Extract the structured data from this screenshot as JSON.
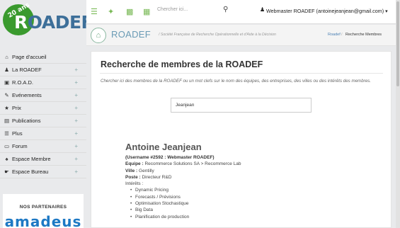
{
  "logo": {
    "anniversary": "20 ans",
    "text_prefix": "",
    "text_r": "R",
    "text_rest": "OADEF"
  },
  "sidebar": {
    "items": [
      {
        "label": "Page d'accueil",
        "icon": "home-icon",
        "has_expand": false
      },
      {
        "label": "La ROADEF",
        "icon": "person-icon",
        "has_expand": true
      },
      {
        "label": "R.O.A.D.",
        "icon": "book-icon",
        "has_expand": true
      },
      {
        "label": "Evénements",
        "icon": "edit-icon",
        "has_expand": true
      },
      {
        "label": "Prix",
        "icon": "trophy-icon",
        "has_expand": true
      },
      {
        "label": "Publications",
        "icon": "document-icon",
        "has_expand": true
      },
      {
        "label": "Plus",
        "icon": "list-icon",
        "has_expand": true
      },
      {
        "label": "Forum",
        "icon": "monitor-icon",
        "has_expand": true
      },
      {
        "label": "Espace Membre",
        "icon": "group-icon",
        "has_expand": true
      },
      {
        "label": "Espace Bureau",
        "icon": "handshake-icon",
        "has_expand": true
      }
    ],
    "partners_title": "NOS PARTENAIRES",
    "partner_logo": "amadeus"
  },
  "topbar": {
    "search_placeholder": "Chercher ici...",
    "user": "Webmaster ROADEF (antoinejeanjean@gmail.com)",
    "icons": [
      "menu-icon",
      "twitter-icon",
      "facebook-icon",
      "linkedin-icon",
      "search-icon",
      "user-icon"
    ]
  },
  "header": {
    "title": "ROADEF",
    "subtitle": "/ Société Française de Recherche Opérationnelle et d'Aide à la Décision",
    "crumb_home": "Roadef",
    "crumb_sep": "/",
    "crumb_current": "Recherche Membres"
  },
  "main": {
    "title": "Recherche de membres de la ROADEF",
    "description": "Chercher ici des membres de la ROADEF ou un mot clefs sur le nom des équipes, des entreprises, des villes ou des intérêts des membres.",
    "search_value": "Jeanjean"
  },
  "person": {
    "name": "Antoine Jeanjean",
    "username_line": "(Username #2592 : Webmaster ROADEF)",
    "equipe_label": "Equipe :",
    "equipe_value": "Recommerce Solutions SA > Recommerce Lab",
    "ville_label": "Ville :",
    "ville_value": "Gentilly",
    "poste_label": "Poste :",
    "poste_value": "Directeur R&D",
    "interets_label": "Intérêts :",
    "interets": [
      "Dynamic Pricing",
      "Forecasts / Prévisions",
      "Optimisation Stochastique",
      "Big Data",
      "Planification de production"
    ]
  },
  "colors": {
    "accent_green": "#3a9a2e",
    "logo_blue": "#3d6f99",
    "header_title": "#6a9bb5",
    "link": "#4a7fb3",
    "partner_blue": "#1e79c4"
  }
}
